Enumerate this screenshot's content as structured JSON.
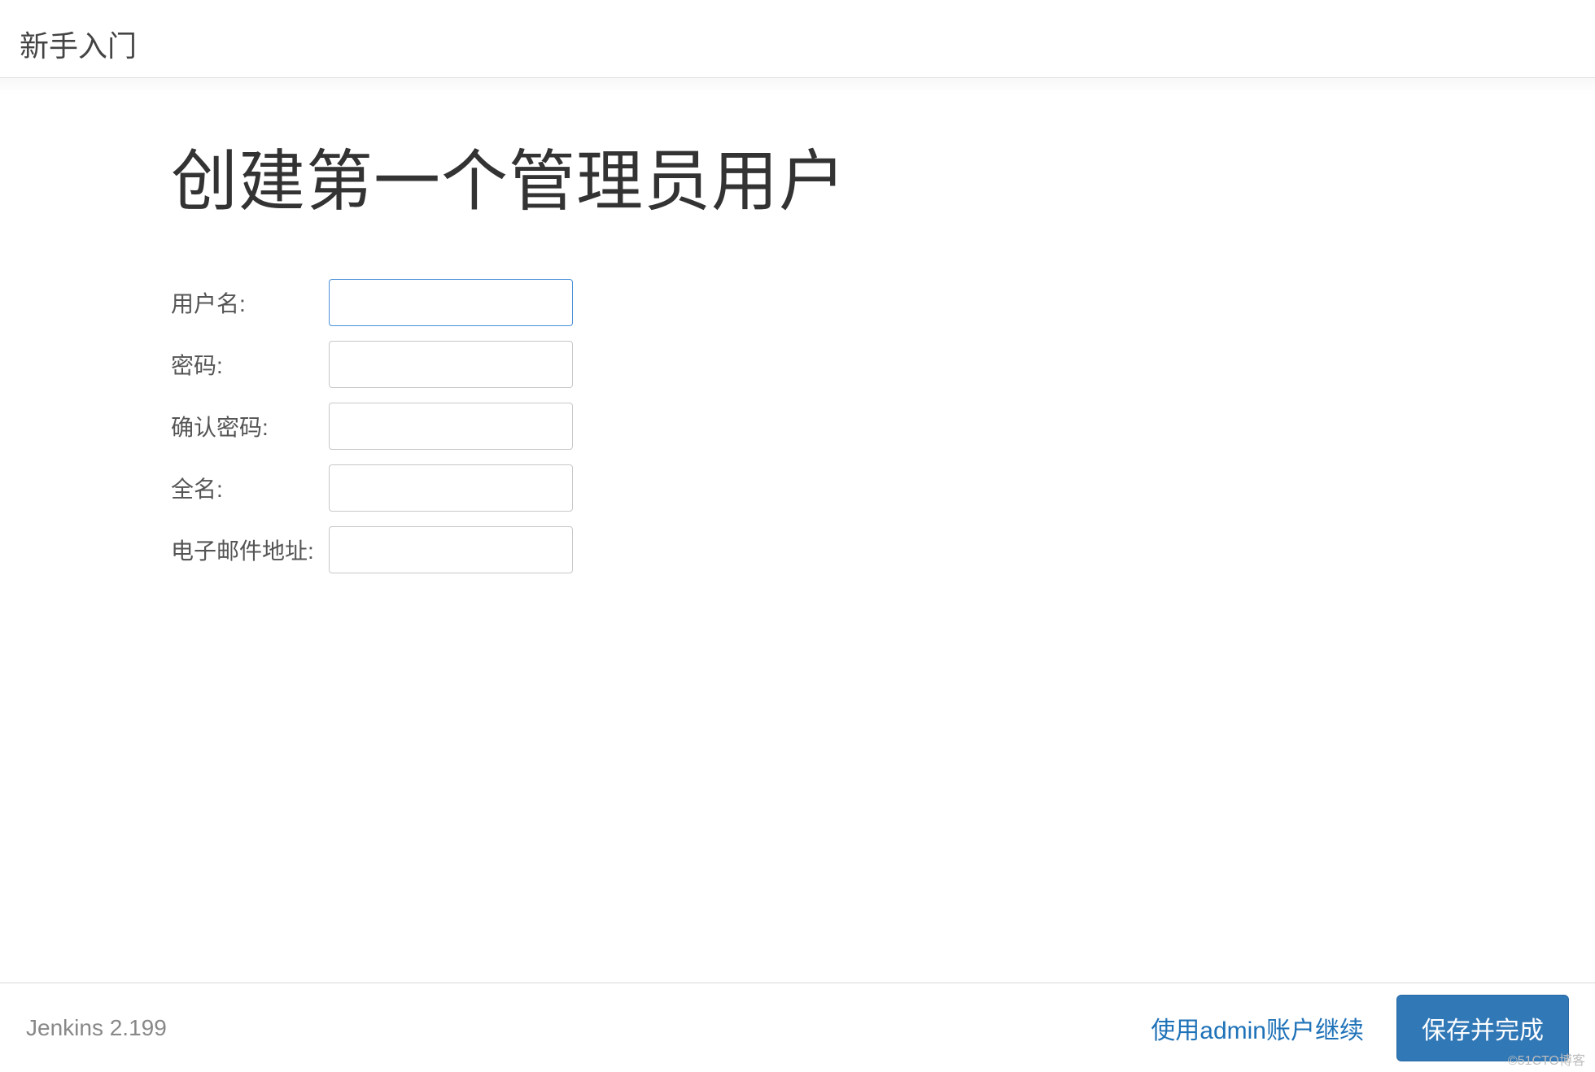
{
  "header": {
    "title": "新手入门"
  },
  "main": {
    "heading": "创建第一个管理员用户",
    "fields": {
      "username_label": "用户名:",
      "username_value": "",
      "password_label": "密码:",
      "password_value": "",
      "confirm_password_label": "确认密码:",
      "confirm_password_value": "",
      "fullname_label": "全名:",
      "fullname_value": "",
      "email_label": "电子邮件地址:",
      "email_value": ""
    }
  },
  "footer": {
    "version": "Jenkins 2.199",
    "continue_as_admin": "使用admin账户继续",
    "save_and_finish": "保存并完成"
  },
  "watermark": "©51CTO博客"
}
